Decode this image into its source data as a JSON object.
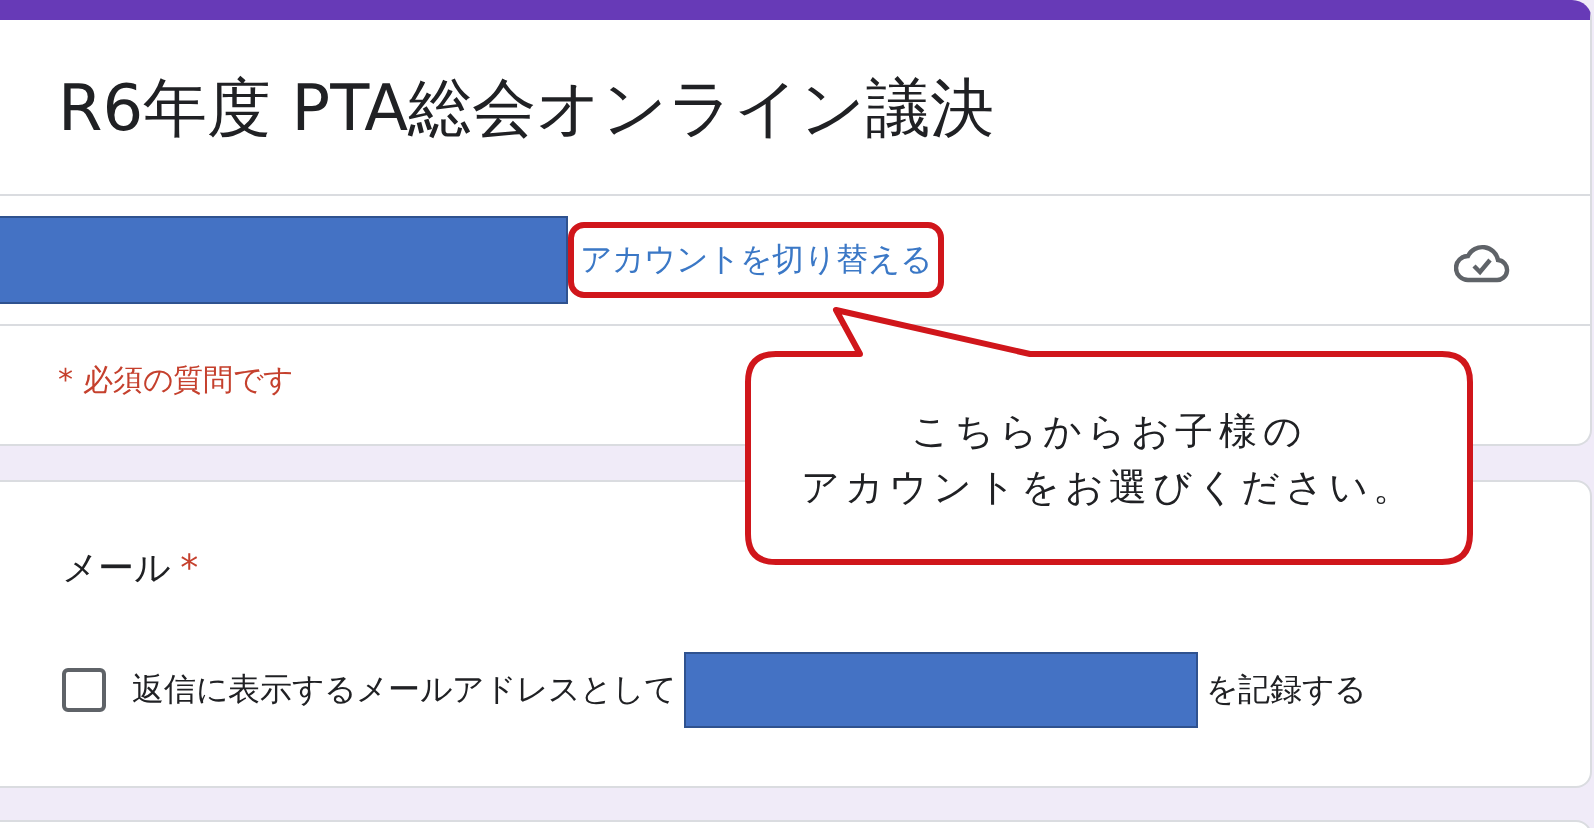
{
  "form": {
    "title": "R6年度 PTA総会オンライン議決",
    "switch_account_link": "アカウントを切り替える",
    "required_note": "* 必須の質問です"
  },
  "callout": {
    "lines": [
      "こちらからお子様の",
      "アカウントをお選びください。"
    ]
  },
  "question": {
    "label": "メール",
    "required_mark": "*",
    "checkbox": {
      "checked": false,
      "text_before": "返信に表示するメールアドレスとして",
      "text_after": "を記録する"
    }
  }
}
